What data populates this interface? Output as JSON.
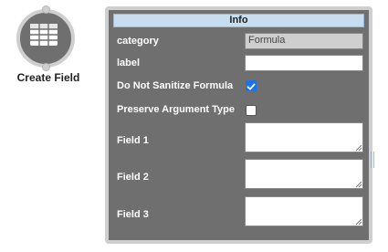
{
  "node": {
    "label": "Create Field",
    "icon": "table-icon"
  },
  "panel": {
    "title": "Info",
    "rows": {
      "category": {
        "label": "category",
        "value": "Formula"
      },
      "label": {
        "label": "label",
        "value": ""
      },
      "do_not_sanitize": {
        "label": "Do Not Sanitize Formula",
        "checked": true
      },
      "preserve_type": {
        "label": "Preserve Argument Type",
        "checked": false
      },
      "field1": {
        "label": "Field 1",
        "value": ""
      },
      "field2": {
        "label": "Field 2",
        "value": ""
      },
      "field3": {
        "label": "Field 3",
        "value": ""
      }
    }
  },
  "colors": {
    "panel_bg": "#6f6f6f",
    "header_bg": "#c7ddf0",
    "checkbox_checked": "#1a73e8"
  }
}
